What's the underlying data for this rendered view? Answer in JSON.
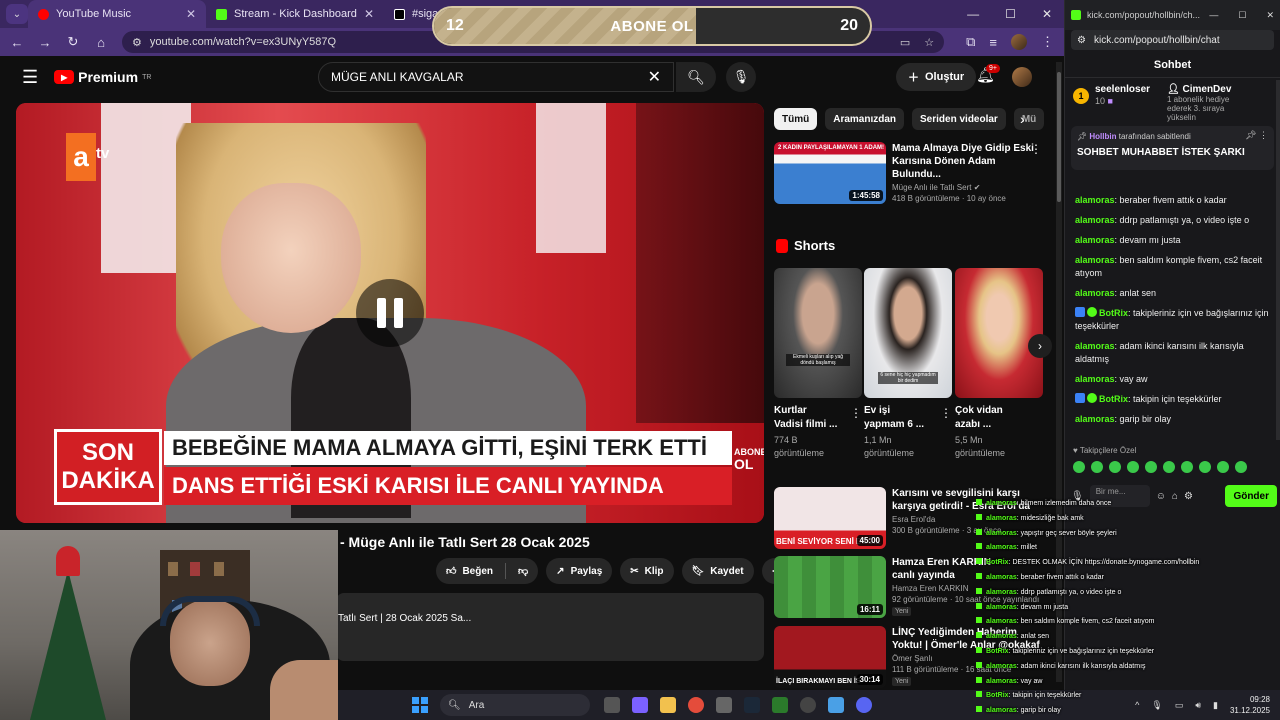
{
  "browser": {
    "tabs": [
      {
        "label": "YouTube Music",
        "color": "#ff0000",
        "active": true
      },
      {
        "label": "Stream - Kick Dashboard",
        "color": "#53fc18",
        "active": false
      },
      {
        "label": "#sigara - Search /",
        "color": "#ffffff",
        "active": false
      }
    ],
    "url": "youtube.com/watch?v=ex3UNyY587Q"
  },
  "youtube": {
    "logo": "Premium",
    "logo_sup": "TR",
    "search_value": "MÜGE ANLI KAVGALAR",
    "create_label": "Oluştur",
    "notif_badge": "9+",
    "video": {
      "channel_logo": "a",
      "channel_logo_tv": "tv",
      "son": "SON",
      "dakika": "DAKİKA",
      "ticker1": "BEBEĞİNE MAMA ALMAYA GİTTİ, EŞİNİ TERK ETTİ",
      "ticker2": "DANS ETTİĞİ ESKİ KARISI İLE CANLI YAYINDA",
      "mini_abone": "ABONE",
      "mini_ol": "OL"
    },
    "title": "- Müge Anlı ile Tatlı Sert 28 Ocak 2025",
    "actions": {
      "like": "Beğen",
      "share": "Paylaş",
      "clip": "Klip",
      "save": "Kaydet"
    },
    "description": "Tatlı Sert | 28 Ocak 2025 Sa...",
    "chips": [
      "Tümü",
      "Aramanızdan",
      "Seriden videolar",
      "Mü"
    ],
    "recs": [
      {
        "title1": "Mama Almaya Diye Gidip Eski",
        "title2": "Karısına Dönen Adam Bulundu...",
        "channel": "Müge Anlı ile Tatlı Sert",
        "views": "418 B görüntüleme · 10 ay önce",
        "duration": "1:45:58",
        "thumb": "2 KADIN PAYLAŞILAMAYAN 1 ADAM!"
      },
      {
        "title1": "Karısını ve sevgilisini karşı",
        "title2": "karşıya getirdi! - Esra Erol'da",
        "channel": "Esra Erol'da",
        "views": "300 B görüntüleme · 3 ay önce",
        "duration": "45:00",
        "thumb": "BENİ SEVİYOR SENİ DEĞİL"
      },
      {
        "title1": "Hamza Eren KARKIN",
        "title2": "canlı yayında",
        "channel": "Hamza Eren KARKIN",
        "views": "92 görüntüleme · 10 saat önce yayınlandı",
        "duration": "16:11",
        "tag": "Yeni"
      },
      {
        "title1": "LİNÇ Yediğimden Haberim",
        "title2": "Yoktu! | Ömer'le Anlar @okakaf",
        "channel": "Ömer Şanlı",
        "views": "111 B görüntüleme · 16 saat önce",
        "duration": "30:14",
        "tag": "Yeni",
        "thumb": "İLAÇI BIRAKMAYI BEN İS"
      }
    ],
    "shorts_label": "Shorts",
    "shorts": [
      {
        "t1": "Kurtlar",
        "t2": "Vadisi filmi ...",
        "v1": "774 B",
        "v2": "görüntüleme",
        "cap": "Ekmeli kuşları alıp yağ döndü başlamış"
      },
      {
        "t1": "Ev işi",
        "t2": "yapmam 6 ...",
        "v1": "1,1 Mn",
        "v2": "görüntüleme",
        "cap": "6 sene hiç hiç yapmadım bir dedim"
      },
      {
        "t1": "Çok vidan",
        "t2": "azabı ...",
        "v1": "5,5 Mn",
        "v2": "görüntüleme",
        "cap": ""
      }
    ]
  },
  "abone_bar": {
    "left": "12",
    "center": "ABONE OL",
    "right": "20",
    "progress": 0.6
  },
  "kick": {
    "tab_url": "kick.com/popout/hollbin/ch...",
    "url": "kick.com/popout/hollbin/chat",
    "header": "Sohbet",
    "gift1": {
      "name": "seelenloser",
      "count": "10",
      "rank": "1"
    },
    "gift2": {
      "name": "CimenDev",
      "line1": "1 abonelik hediye",
      "line2": "ederek 3. sıraya",
      "line3": "yükselin"
    },
    "pinned_by": "Hollbin",
    "pinned_suffix": "tarafından sabitlendi",
    "pinned_text": "SOHBET MUHABBET İSTEK ŞARKI",
    "messages": [
      {
        "user": "alamoras",
        "text": ": beraber fivem attık o kadar"
      },
      {
        "user": "alamoras",
        "text": ": ddrp patlamıştı ya, o video işte o"
      },
      {
        "user": "alamoras",
        "text": ": devam mı justa"
      },
      {
        "user": "alamoras",
        "text": ": ben saldım komple fivem, cs2 faceit atıyom"
      },
      {
        "user": "alamoras",
        "text": ": anlat sen"
      },
      {
        "user": "BotRix",
        "text": ": takipleriniz için ve bağışlarınız için teşekkürler",
        "bot": true
      },
      {
        "user": "alamoras",
        "text": ": adam ikinci karısını ilk karısıyla aldatmış"
      },
      {
        "user": "alamoras",
        "text": ": vay aw"
      },
      {
        "user": "BotRix",
        "text": ": takipin için teşekkürler",
        "bot": true
      },
      {
        "user": "alamoras",
        "text": ": garip bir olay"
      }
    ],
    "emotes_label": "Takipçilere Özel",
    "input_placeholder": "Bir me...",
    "send_label": "Gönder"
  },
  "overlay_chat": [
    {
      "user": "alamoras",
      "text": ": bilmem izlemedim daha önce"
    },
    {
      "user": "alamoras",
      "text": ": midesizliğe bak amk"
    },
    {
      "user": "alamoras",
      "text": ": yapıştır geç sever böyle şeyleri"
    },
    {
      "user": "alamoras",
      "text": ": millet"
    },
    {
      "user": "BotRix",
      "text": ": DESTEK OLMAK İÇİN https://donate.bynogame.com/hollbin"
    },
    {
      "user": "alamoras",
      "text": ": beraber fivem attık o kadar"
    },
    {
      "user": "alamoras",
      "text": ": ddrp patlamıştı ya, o video işte o"
    },
    {
      "user": "alamoras",
      "text": ": devam mı justa"
    },
    {
      "user": "alamoras",
      "text": ": ben saldım komple fivem, cs2 faceit atıyom"
    },
    {
      "user": "alamoras",
      "text": ": anlat sen"
    },
    {
      "user": "BotRix",
      "text": ": takipleriniz için ve bağışlarınız için teşekkürler"
    },
    {
      "user": "alamoras",
      "text": ": adam ikinci karısını ilk karısıyla aldatmış"
    },
    {
      "user": "alamoras",
      "text": ": vay aw"
    },
    {
      "user": "BotRix",
      "text": ": takipin için teşekkürler"
    },
    {
      "user": "alamoras",
      "text": ": garip bir olay"
    }
  ],
  "taskbar": {
    "search_placeholder": "Ara",
    "time": "09:28",
    "date": "31.12.2025"
  }
}
